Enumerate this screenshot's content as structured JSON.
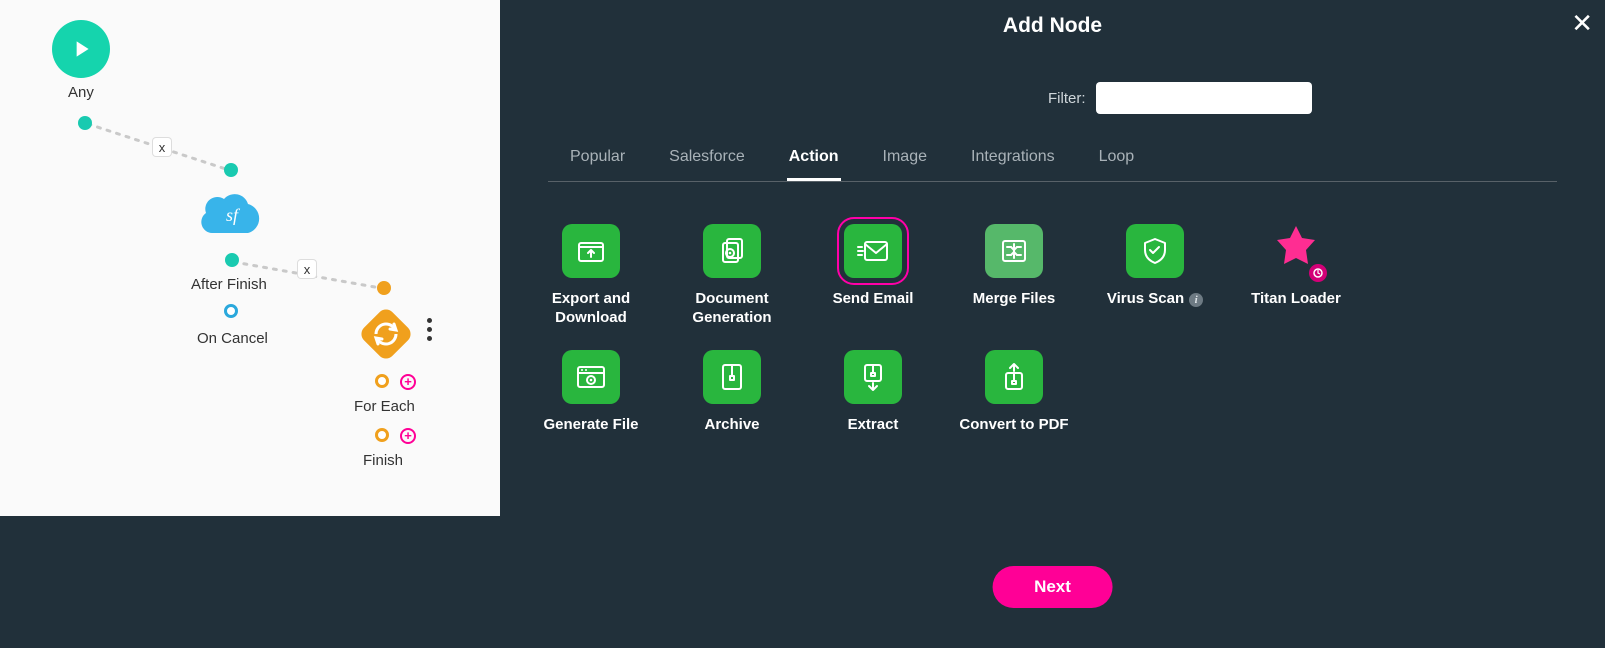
{
  "panel": {
    "title": "Add Node",
    "filter_label": "Filter:",
    "filter_value": "",
    "tabs": [
      "Popular",
      "Salesforce",
      "Action",
      "Image",
      "Integrations",
      "Loop"
    ],
    "active_tab": "Action",
    "next_label": "Next",
    "nodes": [
      {
        "id": "export-download",
        "label": "Export and Download",
        "icon": "upload-folder",
        "color": "green",
        "selected": false
      },
      {
        "id": "document-generation",
        "label": "Document Generation",
        "icon": "documents-gear",
        "color": "green",
        "selected": false
      },
      {
        "id": "send-email",
        "label": "Send Email",
        "icon": "email",
        "color": "green",
        "selected": true
      },
      {
        "id": "merge-files",
        "label": "Merge Files",
        "icon": "merge",
        "color": "greenlt",
        "selected": false
      },
      {
        "id": "virus-scan",
        "label": "Virus Scan",
        "icon": "shield-check",
        "color": "green",
        "selected": false,
        "info": true
      },
      {
        "id": "titan-loader",
        "label": "Titan Loader",
        "icon": "star",
        "color": "pink",
        "selected": false
      },
      {
        "id": "generate-file",
        "label": "Generate File",
        "icon": "browser-gear",
        "color": "green",
        "selected": false
      },
      {
        "id": "archive",
        "label": "Archive",
        "icon": "zip-file",
        "color": "green",
        "selected": false
      },
      {
        "id": "extract",
        "label": "Extract",
        "icon": "zip-down",
        "color": "green",
        "selected": false
      },
      {
        "id": "convert-pdf",
        "label": "Convert to PDF",
        "icon": "zip-up",
        "color": "green",
        "selected": false
      }
    ]
  },
  "flow": {
    "start_label": "Any",
    "sf_label": "After Finish",
    "cancel_label": "On Cancel",
    "foreach_label": "For Each",
    "finish_label": "Finish"
  }
}
